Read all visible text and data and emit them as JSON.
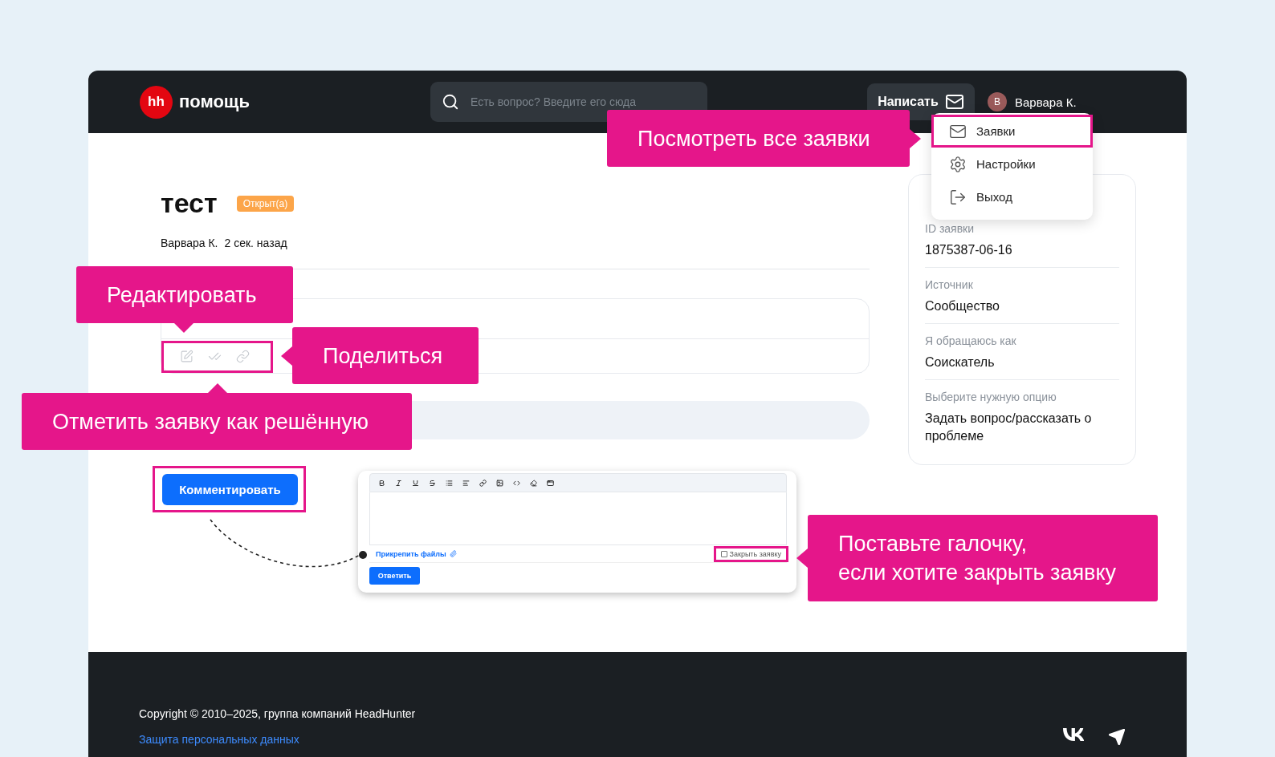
{
  "header": {
    "logo_badge": "hh",
    "logo_text": "помощь",
    "search": {
      "placeholder": "Есть вопрос? Введите его сюда"
    },
    "write_button": "Написать",
    "user": {
      "initial": "В",
      "name": "Варвара К."
    }
  },
  "user_menu": {
    "items": [
      {
        "kind": "mail",
        "label": "Заявки",
        "highlighted": true
      },
      {
        "kind": "settings",
        "label": "Настройки",
        "highlighted": false
      },
      {
        "kind": "logout",
        "label": "Выход",
        "highlighted": false
      }
    ]
  },
  "ticket": {
    "title": "тест",
    "status": "Открыт(а)",
    "author": "Варвара К.",
    "time": "2 сек. назад"
  },
  "comment_toolbar": {
    "highlighted": true,
    "actions": [
      {
        "kind": "edit"
      },
      {
        "kind": "resolve"
      },
      {
        "kind": "link"
      }
    ]
  },
  "comment_button": {
    "label": "Комментировать",
    "highlighted": true
  },
  "editor_preview": {
    "tools": [
      {
        "kind": "bold"
      },
      {
        "kind": "italic"
      },
      {
        "kind": "underline"
      },
      {
        "kind": "strike"
      },
      {
        "kind": "list"
      },
      {
        "kind": "align"
      },
      {
        "kind": "link"
      },
      {
        "kind": "image"
      },
      {
        "kind": "code"
      },
      {
        "kind": "eraser"
      },
      {
        "kind": "embed"
      }
    ],
    "attach": "Прикрепить файлы",
    "close_checkbox": {
      "label": "Закрыть заявку",
      "checked": false,
      "highlighted": true
    },
    "reply_button": "Ответить"
  },
  "details_card": {
    "fields": [
      {
        "label": "ID заявки",
        "value": "1875387-06-16"
      },
      {
        "label": "Источник",
        "value": "Сообщество"
      },
      {
        "label": "Я обращаюсь как",
        "value": "Соискатель"
      },
      {
        "label": "Выберите нужную опцию",
        "value": "Задать вопрос/рассказать о проблеме"
      }
    ]
  },
  "footer": {
    "copyright": "Copyright © 2010–2025, группа компаний HeadHunter",
    "privacy_link": "Защита персональных данных",
    "social": [
      {
        "kind": "vk"
      },
      {
        "kind": "telegram"
      }
    ]
  },
  "callouts": [
    {
      "text": "Посмотреть все заявки",
      "kind": "right"
    },
    {
      "text": "Редактировать",
      "kind": "down"
    },
    {
      "text": "Поделиться",
      "kind": "left"
    },
    {
      "text": "Отметить заявку как решённую",
      "kind": "up"
    },
    {
      "text": "Поставьте галочку,\nесли хотите закрыть заявку",
      "kind": "left"
    }
  ]
}
